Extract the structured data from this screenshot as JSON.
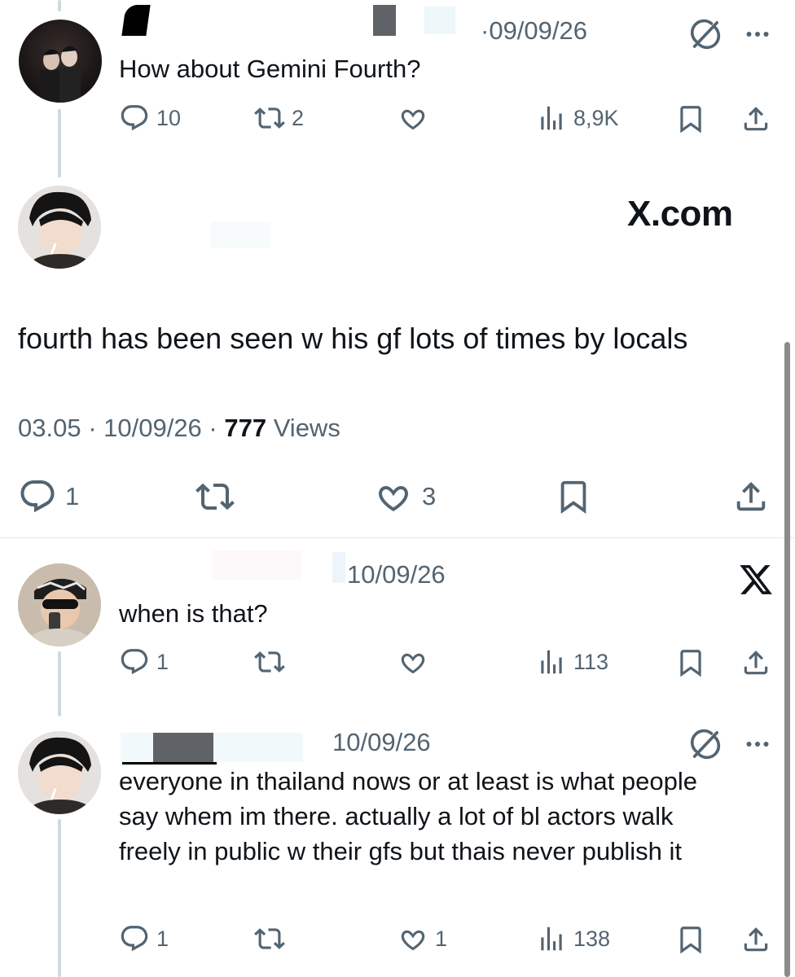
{
  "tweet1": {
    "date": "·09/09/26",
    "text": "How about Gemini Fourth?",
    "replies": "10",
    "retweets": "2",
    "likes": "",
    "views": "8,9K"
  },
  "tweet2": {
    "watermark": "X.com",
    "text": "fourth has been seen w his gf lots of times by locals",
    "meta_time": "03.05 · 10/09/26 · ",
    "meta_views_count": "777",
    "meta_views_label": " Views",
    "replies": "1",
    "retweets": "",
    "likes": "3"
  },
  "tweet3": {
    "date": "10/09/26",
    "text": "when is that?",
    "replies": "1",
    "retweets": "",
    "likes": "",
    "views": "113"
  },
  "tweet4": {
    "date": "10/09/26",
    "text": "everyone in thailand nows or at least is what people say whem im there. actually a lot of bl actors walk freely in public w their gfs but thais never publish it",
    "replies": "1",
    "retweets": "",
    "likes": "1",
    "views": "138"
  },
  "icons": {
    "reply": "reply-icon",
    "retweet": "retweet-icon",
    "like": "heart-icon",
    "views": "views-icon",
    "bookmark": "bookmark-icon",
    "share": "share-icon",
    "grok": "grok-icon",
    "more": "more-icon",
    "x_logo": "x-logo-icon"
  },
  "colors": {
    "text": "#0f1419",
    "secondary": "#536471",
    "thread_line": "#cfd9de"
  }
}
